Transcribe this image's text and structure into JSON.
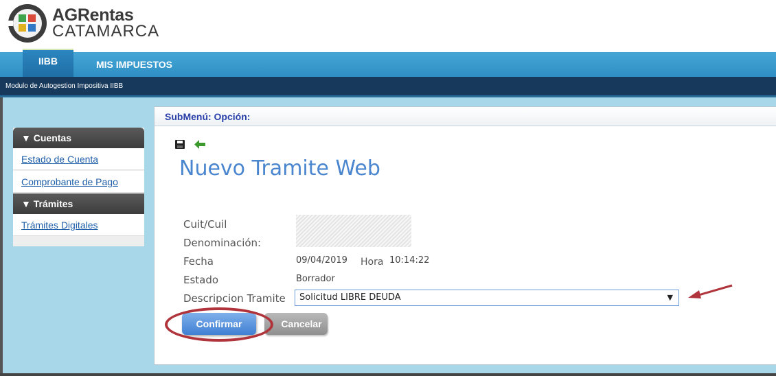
{
  "brand": {
    "title": "AGRentas",
    "subtitle": "CATAMARCA"
  },
  "nav": {
    "tabs": [
      "IIBB",
      "MIS IMPUESTOS"
    ],
    "active_tab": "IIBB"
  },
  "module_label": "Modulo de Autogestion Impositiva IIBB",
  "sidebar": {
    "sections": [
      {
        "header": "▼ Cuentas",
        "items": [
          "Estado de Cuenta",
          "Comprobante de Pago"
        ]
      },
      {
        "header": "▼ Trámites",
        "items": [
          "Trámites Digitales"
        ]
      }
    ]
  },
  "panel": {
    "header": "SubMenú: Opción:"
  },
  "toolbar": {
    "icons": [
      "save-icon",
      "back-arrow-icon"
    ]
  },
  "page_title": "Nuevo Tramite Web",
  "form": {
    "cuit_label": "Cuit/Cuil",
    "denominacion_label": "Denominación:",
    "fecha_label": "Fecha",
    "fecha_value": "09/04/2019",
    "hora_label": "Hora",
    "hora_value": "10:14:22",
    "estado_label": "Estado",
    "estado_value": "Borrador",
    "descripcion_label": "Descripcion Tramite",
    "descripcion_value": "Solicitud LIBRE DEUDA"
  },
  "buttons": {
    "confirm": "Confirmar",
    "cancel": "Cancelar"
  },
  "colors": {
    "accent": "#4a86cf",
    "nav": "#3a9bd0",
    "annotation": "#b0343b"
  }
}
